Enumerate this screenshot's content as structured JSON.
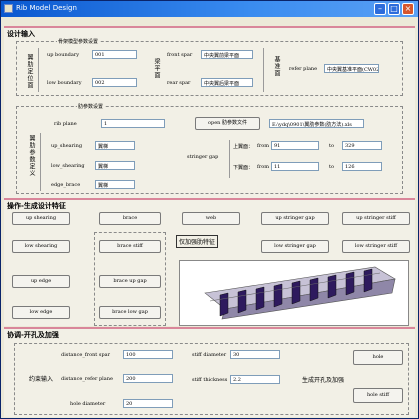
{
  "window": {
    "title": "Rib Model Design"
  },
  "design_input": {
    "title": "设计输入",
    "skeleton_group": {
      "label": "骨架模型参数设置",
      "side_label": "翼肋定位面",
      "up_boundary_label": "up boundary",
      "up_boundary_value": "001",
      "low_boundary_label": "low boundary",
      "low_boundary_value": "002",
      "spar_label": "梁平面",
      "front_spar_label": "front spar",
      "front_spar_value": "中央翼前梁平面",
      "rear_spar_label": "rear spar",
      "rear_spar_value": "中央翼后梁平面",
      "refer_side_label": "基准面",
      "refer_plane_label": "refer plane",
      "refer_plane_value": "中央翼基准平面(CW02)"
    },
    "rib_group": {
      "label": "肋参数设置",
      "side_label": "翼肋参数定义",
      "rib_plane_label": "rib plane",
      "rib_plane_value": "1",
      "open_button": "open 肋参数文件",
      "file_path": "E:\\ydq\\0901\\翼肋参数(肋方法).xls",
      "up_shearing_label": "up_shearing",
      "up_shearing_value": "翼梯",
      "low_shearing_label": "low_shearing",
      "low_shearing_value": "翼梯",
      "edge_brace_label": "edge_brace",
      "edge_brace_value": "翼梯",
      "stringer_gap_label": "stringer gap",
      "upper_label": "上翼面：",
      "lower_label": "下翼面：",
      "from_label": "from",
      "to_label": "to",
      "upper_from": "91",
      "upper_to": "329",
      "lower_from": "11",
      "lower_to": "126"
    }
  },
  "operation": {
    "title": "操作-生成设计特征",
    "buttons": {
      "up_shearing": "up shearing",
      "brace": "brace",
      "web": "web",
      "up_stringer_gap": "up stringer gap",
      "up_stringer_stiff": "up stringer stiff",
      "low_shearing": "low shearing",
      "brace_stiff": "brace stiff",
      "low_stringer_gap": "low stringer gap",
      "low_stringer_stiff": "low stringer stiff",
      "up_edge": "up edge",
      "brace_up_gap": "brace up gap",
      "low_edge": "low edge",
      "brace_low_gap": "brace low gap"
    },
    "note": "仅加强肋特征"
  },
  "coordinate": {
    "title": "协调-开孔及加强",
    "left_label": "约束输入",
    "right_label": "生成开孔及加强",
    "distance_front_spar_label": "distance_front spar",
    "distance_front_spar_value": "100",
    "distance_refer_plane_label": "distance_refer plane",
    "distance_refer_plane_value": "200",
    "hole_diameter_label": "hole diameter",
    "hole_diameter_value": "20",
    "stiff_diameter_label": "stiff diameter",
    "stiff_diameter_value": "30",
    "stiff_thickness_label": "stiff thickness",
    "stiff_thickness_value": "2.2",
    "hole_button": "hole",
    "hole_stiff_button": "hole stiff"
  },
  "colors": {
    "title_bar": "#0a58d0",
    "section_divider": "#d9869a",
    "model_bars": "#2e1a5e"
  }
}
